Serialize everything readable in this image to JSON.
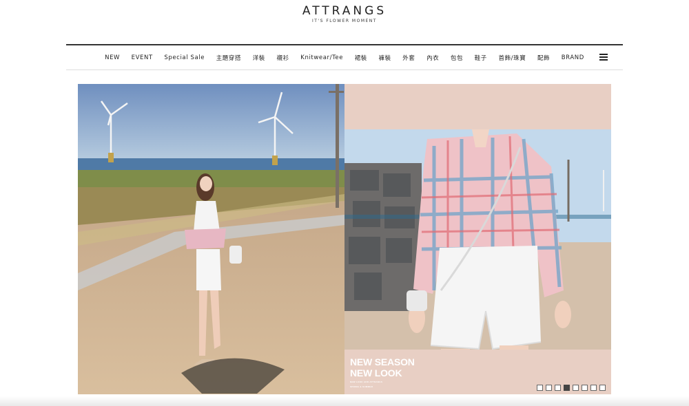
{
  "brand": {
    "name": "ATTRANGS",
    "tagline": "IT'S FLOWER MOMENT"
  },
  "nav": {
    "items": [
      "NEW",
      "EVENT",
      "Special Sale",
      "主題穿搭",
      "洋裝",
      "襯衫",
      "Knitwear/Tee",
      "裙裝",
      "褲裝",
      "外套",
      "內衣",
      "包包",
      "鞋子",
      "首飾/珠寶",
      "配飾",
      "BRAND"
    ],
    "menu_icon": "hamburger-icon"
  },
  "banner": {
    "headline_line1": "NEW SEASON",
    "headline_line2": "NEW LOOK",
    "fine_print_1": "NEW LOOK ADD ATTRANGS",
    "fine_print_2": "SPRING & SUMMER",
    "slide_count": 8,
    "active_slide_index": 3
  },
  "colors": {
    "accent_pink": "#e8cfc4",
    "text": "#222222"
  }
}
